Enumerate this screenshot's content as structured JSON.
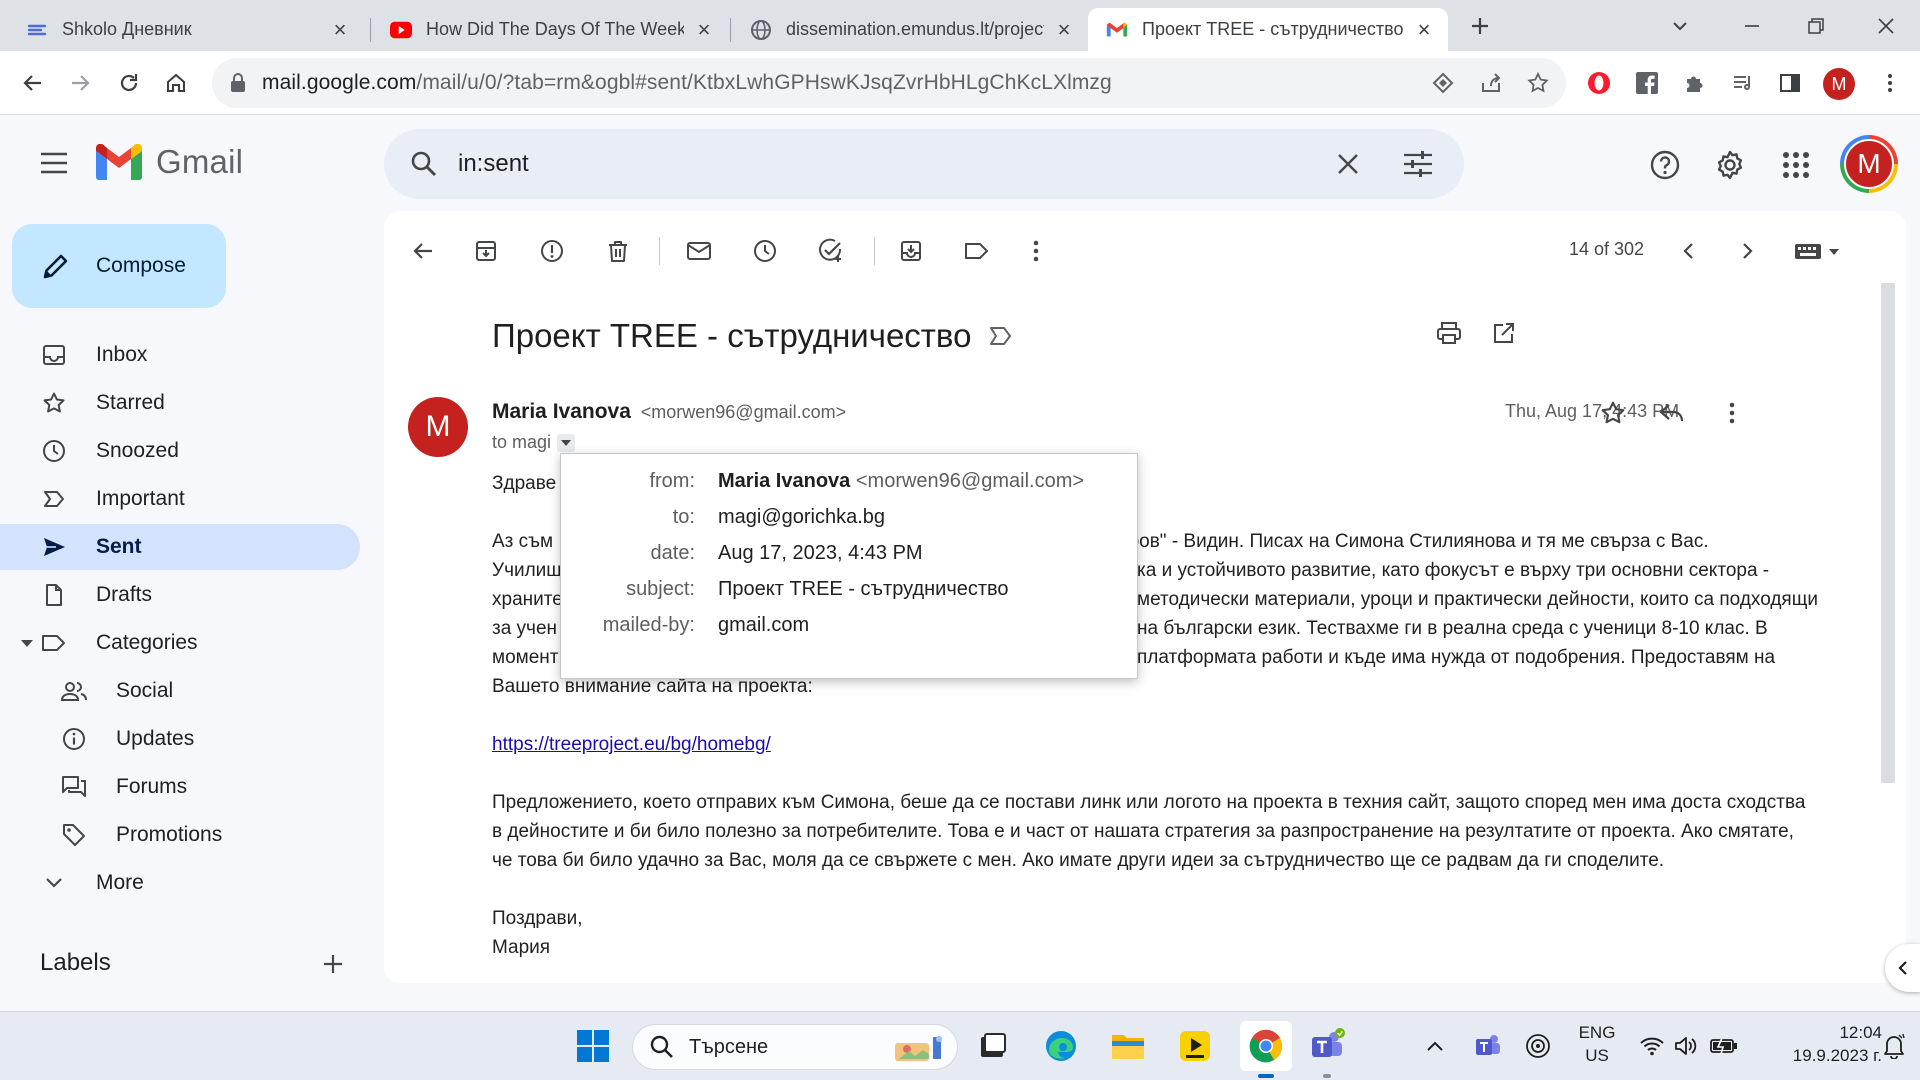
{
  "browser": {
    "tabs": [
      {
        "title": "Shkolo Дневник",
        "icon": "shkolo-icon",
        "active": false
      },
      {
        "title": "How Did The Days Of The Week G",
        "icon": "youtube-icon",
        "active": false
      },
      {
        "title": "dissemination.emundus.lt/project",
        "icon": "globe-icon",
        "active": false
      },
      {
        "title": "Проект TREE - сътрудничество -",
        "icon": "gmail-icon",
        "active": true
      }
    ],
    "url_host": "mail.google.com",
    "url_path": "/mail/u/0/?tab=rm&ogbl#sent/KtbxLwhGPHswKJsqZvrHbHLgChKcLXlmzg",
    "profile_initial": "M"
  },
  "gmail": {
    "logo_text": "Gmail",
    "search_value": "in:sent",
    "account_initial": "M",
    "compose_label": "Compose",
    "nav": [
      {
        "label": "Inbox",
        "icon": "inbox-icon"
      },
      {
        "label": "Starred",
        "icon": "star-icon"
      },
      {
        "label": "Snoozed",
        "icon": "clock-icon"
      },
      {
        "label": "Important",
        "icon": "important-icon"
      },
      {
        "label": "Sent",
        "icon": "send-icon"
      },
      {
        "label": "Drafts",
        "icon": "draft-icon"
      },
      {
        "label": "Categories",
        "icon": "label-icon"
      },
      {
        "label": "Social",
        "icon": "people-icon"
      },
      {
        "label": "Updates",
        "icon": "info-icon"
      },
      {
        "label": "Forums",
        "icon": "forum-icon"
      },
      {
        "label": "Promotions",
        "icon": "tag-icon"
      },
      {
        "label": "More",
        "icon": "chevron-down-icon"
      }
    ],
    "labels_heading": "Labels",
    "pager": "14 of 302"
  },
  "email": {
    "subject": "Проект TREE - сътрудничество",
    "sender_initial": "M",
    "sender_name": "Maria Ivanova",
    "sender_email": "<morwen96@gmail.com>",
    "to_line": "to magi",
    "date": "Thu, Aug 17, 4:43 PM",
    "greeting": "Здраве",
    "para1_lines": [
      "Аз съм",
      "Училищ",
      "храните",
      "за учен",
      "момент",
      "Вашето внимание сайта на проекта:"
    ],
    "para1_right": [
      "аров\" - Видин. Писах на Симона Стилиянова и тя ме свърза с Вас.",
      "ка и устойчивото развитие, като фокусът е върху три основни сектора -",
      "методически материали, уроци и практически дейности, които са подходящи",
      "на български език. Тествахме ги в реална среда с ученици 8-10 клас. В",
      "платформата работи и къде има нужда от подобрения. Предоставям на"
    ],
    "link": "https://treeproject.eu/bg/homebg/",
    "para2_lines": [
      "Предложението, което отправих към Симона, беше да се постави линк или логото на проекта в техния сайт, защото според мен има доста сходства",
      "в дейностите и би било полезно за потребителите. Това е и част от нашата стратегия за разпространение на резултатите от проекта. Ако смятате,",
      "че това би било удачно за Вас, моля да се свържете с мен. Ако имате други идеи за сътрудничество ще се радвам да ги споделите."
    ],
    "closing": "Поздрави,",
    "signature": "Мария"
  },
  "details_popup": {
    "from_label": "from:",
    "from_name": "Maria Ivanova",
    "from_email": "<morwen96@gmail.com>",
    "to_label": "to:",
    "to_value": "magi@gorichka.bg",
    "date_label": "date:",
    "date_value": "Aug 17, 2023, 4:43 PM",
    "subject_label": "subject:",
    "subject_value": "Проект TREE - сътрудничество",
    "mailedby_label": "mailed-by:",
    "mailedby_value": "gmail.com"
  },
  "taskbar": {
    "search_label": "Търсене",
    "lang_top": "ENG",
    "lang_bottom": "US",
    "time": "12:04",
    "date": "19.9.2023 г."
  },
  "colors": {
    "accent": "#0b57d0",
    "compose_bg": "#c2e7ff",
    "active_nav_bg": "#d3e3fd",
    "avatar_bg": "#c5221f",
    "link": "#1a0dab"
  }
}
